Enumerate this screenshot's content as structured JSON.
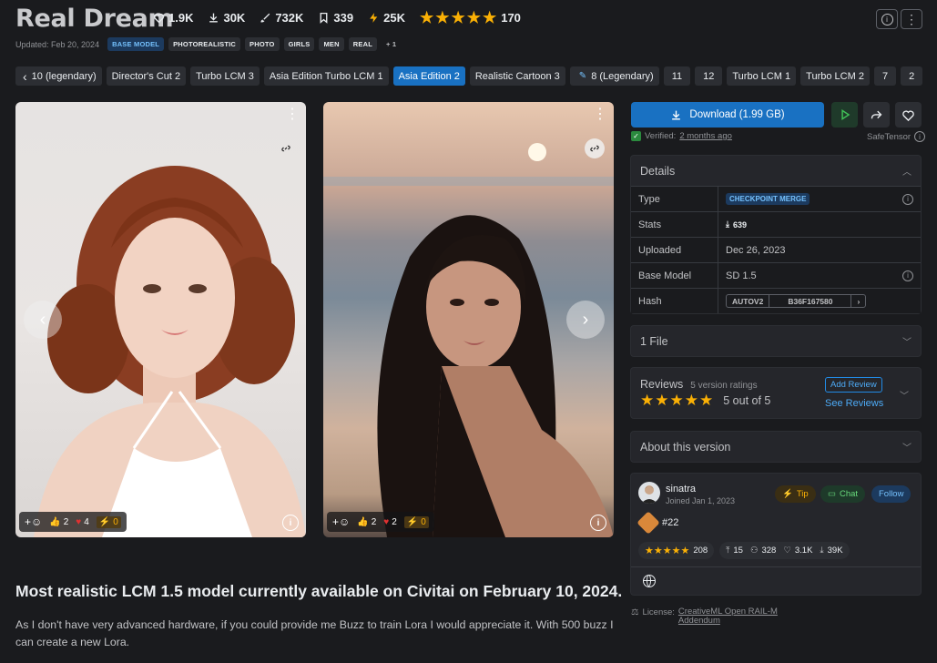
{
  "model": {
    "title": "Real Dream",
    "likes": "1.9K",
    "downloads": "30K",
    "generations": "732K",
    "collected": "339",
    "buzz": "25K",
    "rating_count": "170",
    "updated": "Updated: Feb 20, 2024",
    "tags": [
      "BASE MODEL",
      "PHOTOREALISTIC",
      "PHOTO",
      "GIRLS",
      "MEN",
      "REAL",
      "+ 1"
    ]
  },
  "versions": [
    "10 (legendary)",
    "Director's Cut 2",
    "Turbo LCM 3",
    "Asia Edition Turbo LCM 1",
    "Asia Edition 2",
    "Realistic Cartoon 3",
    "8 (Legendary)",
    "11",
    "12",
    "Turbo LCM 1",
    "Turbo LCM 2",
    "7",
    "2"
  ],
  "active_version": "Asia Edition 2",
  "images": [
    {
      "likes": "2",
      "hearts": "4",
      "buzz": "0"
    },
    {
      "likes": "2",
      "hearts": "2",
      "buzz": "0"
    }
  ],
  "description": {
    "heading": "Most realistic LCM 1.5 model currently available on Civitai on February 10, 2024.",
    "body": "As I don't have very advanced hardware, if you could provide me Buzz to train Lora I would appreciate it. With 500 buzz I can create a new Lora."
  },
  "download": {
    "label": "Download (1.99 GB)",
    "verified_label": "Verified:",
    "verified_when": "2 months ago",
    "format": "SafeTensor"
  },
  "details": {
    "heading": "Details",
    "type_label": "Type",
    "type_value": "CHECKPOINT MERGE",
    "stats_label": "Stats",
    "stats_downloads": "639",
    "uploaded_label": "Uploaded",
    "uploaded_value": "Dec 26, 2023",
    "base_label": "Base Model",
    "base_value": "SD 1.5",
    "hash_label": "Hash",
    "hash_type": "AUTOV2",
    "hash_value": "B36F167580"
  },
  "files": {
    "heading": "1 File"
  },
  "reviews": {
    "heading": "Reviews",
    "count": "5 version ratings",
    "score": "5 out of 5",
    "add": "Add Review",
    "see": "See Reviews"
  },
  "about": {
    "heading": "About this version"
  },
  "creator": {
    "name": "sinatra",
    "joined": "Joined Jan 1, 2023",
    "rank": "#22",
    "tip": "Tip",
    "chat": "Chat",
    "follow": "Follow",
    "rating_count": "208",
    "uploads": "15",
    "followers": "328",
    "likes": "3.1K",
    "downloads": "39K"
  },
  "license": {
    "label": "License:",
    "name": "CreativeML Open RAIL-M",
    "addendum": "Addendum"
  },
  "colors": {
    "accent": "#1971c2",
    "star": "#fab005",
    "background": "#1a1b1e"
  }
}
